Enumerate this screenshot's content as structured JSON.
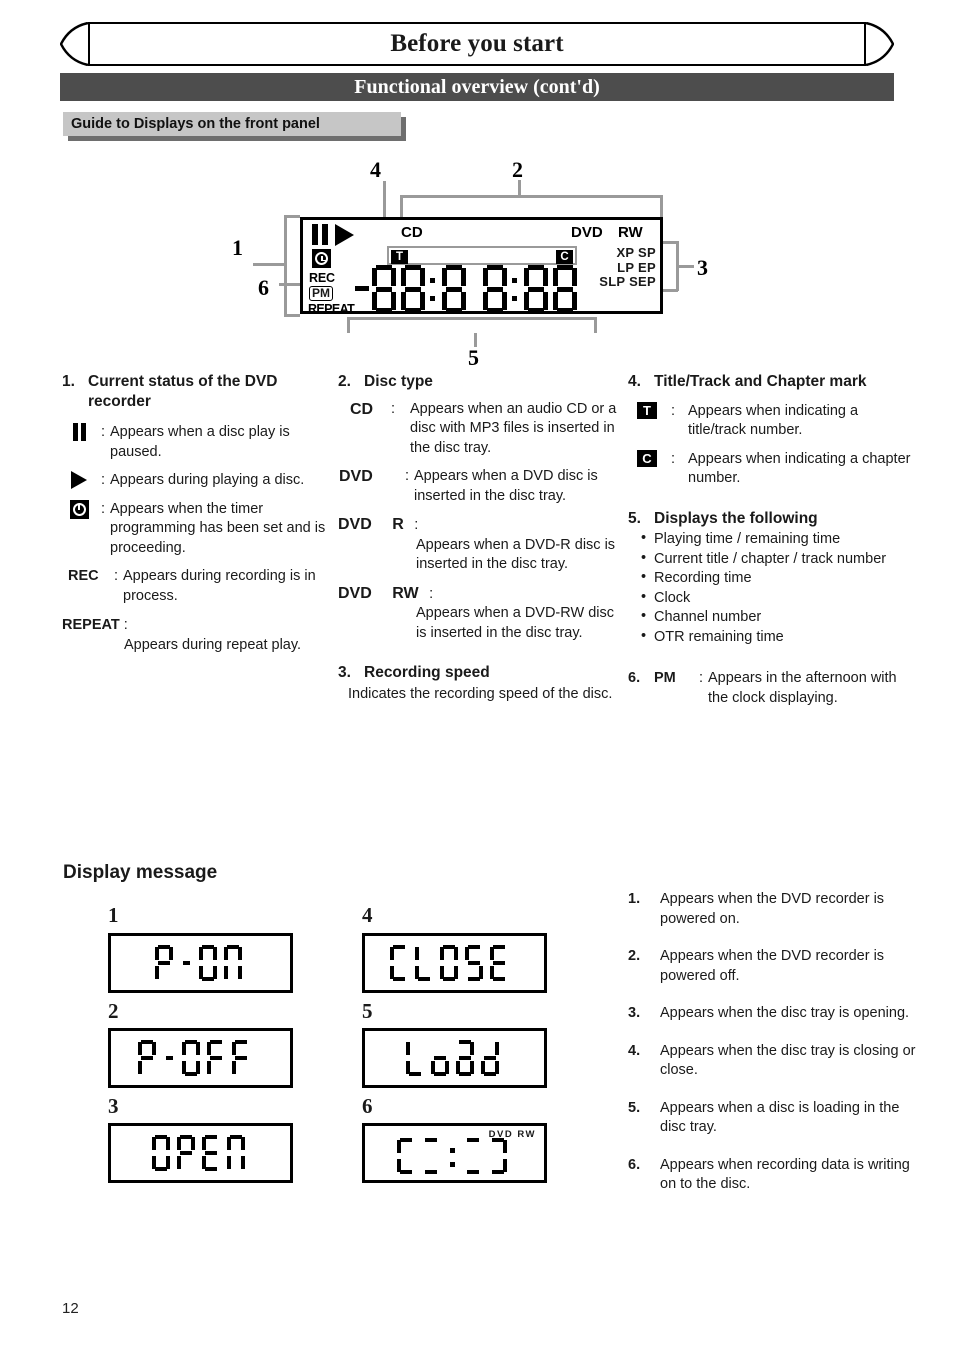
{
  "running_head": "Before you start",
  "section_bar": "Functional overview (cont'd)",
  "sub_heading": "Guide to Displays on the front panel",
  "front_panel": {
    "callouts": {
      "one": "1",
      "two": "2",
      "three": "3",
      "four": "4",
      "five": "5",
      "six": "6"
    },
    "labels": {
      "cd": "CD",
      "dvd": "DVD",
      "rw": "RW",
      "rec": "REC",
      "pm": "PM",
      "repeat": "REPEAT",
      "title_mark": "T",
      "chapter_mark": "C",
      "speed_line1": "XP SP",
      "speed_line2": "LP EP",
      "speed_line3": "SLP SEP"
    }
  },
  "col1": {
    "num": "1.",
    "title": "Current status of the DVD recorder",
    "items": [
      {
        "icon": "pause-icon",
        "sep": ":",
        "text": "Appears when a disc play is paused."
      },
      {
        "icon": "play-icon",
        "sep": ":",
        "text": "Appears during playing a disc."
      },
      {
        "icon": "timer-clock-icon",
        "sep": ":",
        "text": "Appears when the timer programming has been set and is proceeding."
      },
      {
        "key": "REC",
        "sep": ":",
        "text": "Appears during recording is in process."
      }
    ],
    "repeat_key": "REPEAT",
    "repeat_sep": ":",
    "repeat_text": "Appears during repeat play."
  },
  "col2": {
    "num": "2.",
    "title": "Disc type",
    "items": [
      {
        "key": "CD",
        "sub": "",
        "sep": ":",
        "text": "Appears when an audio CD or a disc with MP3 files is inserted in the disc tray."
      },
      {
        "key": "DVD",
        "sub": "",
        "sep": ":",
        "text": "Appears when a DVD disc is inserted in the disc tray."
      },
      {
        "key": "DVD",
        "sub": "R",
        "sep": ":",
        "text": "Appears when a DVD-R disc is inserted in the disc tray."
      },
      {
        "key": "DVD",
        "sub": "RW",
        "sep": ":",
        "text": "Appears when a DVD-RW disc is inserted in the disc tray."
      }
    ],
    "num3": "3.",
    "title3": "Recording speed",
    "body3": "Indicates the recording speed of the disc."
  },
  "col3": {
    "num": "4.",
    "title": "Title/Track and Chapter mark",
    "items": [
      {
        "mark": "T",
        "sep": ":",
        "text": "Appears when indicating a title/track number."
      },
      {
        "mark": "C",
        "sep": ":",
        "text": "Appears when indicating a chapter number."
      }
    ],
    "num5": "5.",
    "title5": "Displays the following",
    "bullets5": [
      "Playing time / remaining time",
      "Current title / chapter / track number",
      "Recording time",
      "Clock",
      "Channel number",
      "OTR remaining time"
    ],
    "num6": "6.",
    "key6": "PM",
    "sep6": ":",
    "text6": "Appears in the afternoon with the clock displaying."
  },
  "display_message": {
    "title": "Display message",
    "boxes": [
      {
        "num": "1",
        "text": "P - ON",
        "badge": ""
      },
      {
        "num": "2",
        "text": "P - OFF",
        "badge": ""
      },
      {
        "num": "3",
        "text": "OPEN",
        "badge": ""
      },
      {
        "num": "4",
        "text": "CLOSE",
        "badge": ""
      },
      {
        "num": "5",
        "text": "Load",
        "badge": ""
      },
      {
        "num": "6",
        "text": "C - - J",
        "badge": "DVD  RW"
      }
    ],
    "explanations": [
      {
        "n": "1.",
        "t": "Appears when the DVD recorder is powered on."
      },
      {
        "n": "2.",
        "t": "Appears when the DVD recorder is powered off."
      },
      {
        "n": "3.",
        "t": "Appears when the disc tray is opening."
      },
      {
        "n": "4.",
        "t": "Appears when the disc tray is closing or close."
      },
      {
        "n": "5.",
        "t": "Appears when a disc is loading in the disc tray."
      },
      {
        "n": "6.",
        "t": "Appears when recording data is writing on to the disc."
      }
    ]
  },
  "page_number": "12",
  "colors": {
    "bar": "#4d4d4d",
    "chip": "#c6c6c6",
    "chip_shadow": "#6e6e6e",
    "leader": "#9a9a9a"
  }
}
